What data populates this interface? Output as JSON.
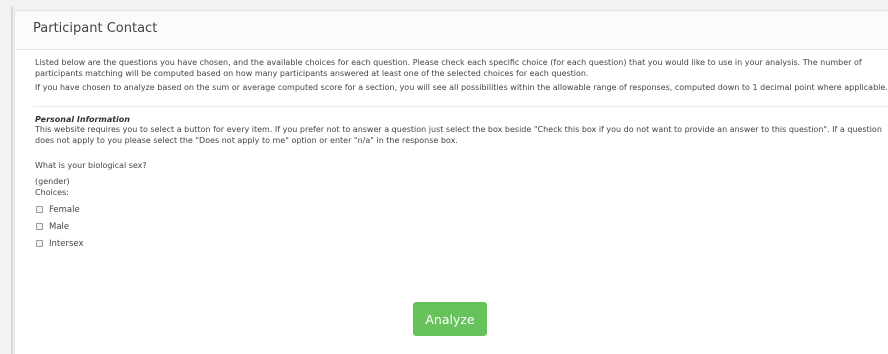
{
  "panel": {
    "title": "Participant Contact"
  },
  "intro": {
    "paragraph1": "Listed below are the questions you have chosen, and the available choices for each question. Please check each specific choice (for each question) that you would like to use in your analysis. The number of participants matching will be computed based on how many participants answered at least one of the selected choices for each question.",
    "paragraph2": "If you have chosen to analyze based on the sum or average computed score for a section, you will see all possibilities within the allowable range of responses, computed down to 1 decimal point where applicable."
  },
  "section": {
    "title": "Personal Information",
    "description": "This website requires you to select a button for every item. If you prefer not to answer a question just select the box beside \"Check this box if you do not want to provide an answer to this question\". If a question does not apply to you please select the \"Does not apply to me\" option or enter \"n/a\" in the response box."
  },
  "question": {
    "text": "What is your biological sex?",
    "code": "(gender)",
    "choices_label": "Choices:",
    "choices": [
      {
        "label": "Female",
        "checked": false
      },
      {
        "label": "Male",
        "checked": false
      },
      {
        "label": "Intersex",
        "checked": false
      }
    ]
  },
  "actions": {
    "analyze_label": "Analyze"
  },
  "colors": {
    "analyze_button": "#67c25c",
    "background": "#f2f2f4",
    "panel": "#ffffff"
  }
}
